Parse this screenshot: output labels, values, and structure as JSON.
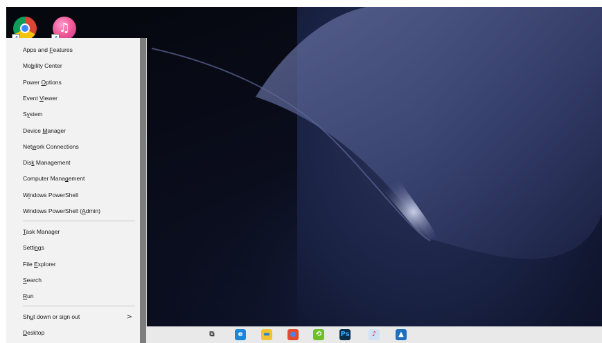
{
  "desktop": {
    "icons": [
      {
        "name": "chrome-icon"
      },
      {
        "name": "itunes-icon",
        "glyph": "♫"
      }
    ]
  },
  "menu": {
    "group1": [
      {
        "pre": "Apps and ",
        "u": "F",
        "post": "eatures"
      },
      {
        "pre": "Mo",
        "u": "b",
        "post": "ility Center"
      },
      {
        "pre": "Power ",
        "u": "O",
        "post": "ptions"
      },
      {
        "pre": "Event ",
        "u": "V",
        "post": "iewer"
      },
      {
        "pre": "S",
        "u": "y",
        "post": "stem"
      },
      {
        "pre": "Device ",
        "u": "M",
        "post": "anager"
      },
      {
        "pre": "Net",
        "u": "w",
        "post": "ork Connections"
      },
      {
        "pre": "Dis",
        "u": "k",
        "post": " Management"
      },
      {
        "pre": "Computer Mana",
        "u": "g",
        "post": "ement"
      },
      {
        "pre": "W",
        "u": "i",
        "post": "ndows PowerShell"
      },
      {
        "pre": "Windows PowerShell (",
        "u": "A",
        "post": "dmin)"
      }
    ],
    "group2": [
      {
        "pre": "",
        "u": "T",
        "post": "ask Manager"
      },
      {
        "pre": "Setti",
        "u": "n",
        "post": "gs"
      },
      {
        "pre": "File ",
        "u": "E",
        "post": "xplorer"
      },
      {
        "pre": "",
        "u": "S",
        "post": "earch"
      },
      {
        "pre": "",
        "u": "R",
        "post": "un"
      }
    ],
    "group3": [
      {
        "pre": "Sh",
        "u": "u",
        "post": "t down or sign out",
        "chevron": ">"
      },
      {
        "pre": "",
        "u": "D",
        "post": "esktop"
      }
    ]
  },
  "taskbar": {
    "icons": [
      {
        "name": "task-view-icon",
        "glyph": "⧉",
        "color": "#e9e9e9",
        "fg": "#333333"
      },
      {
        "name": "edge-icon",
        "glyph": "e",
        "color": "#1c87d6",
        "fg": "#ffffff"
      },
      {
        "name": "file-explorer-icon",
        "glyph": "▬",
        "color": "#f2c230",
        "fg": "#2d7fd3"
      },
      {
        "name": "chrome-taskbar-icon",
        "glyph": "●",
        "color": "#e64a2e",
        "fg": "#4285f4"
      },
      {
        "name": "green-app-icon",
        "glyph": "⟲",
        "color": "#6fbf2c",
        "fg": "#ffffff"
      },
      {
        "name": "photoshop-icon",
        "glyph": "Ps",
        "color": "#0b2d4a",
        "fg": "#31a8ff"
      },
      {
        "name": "itunes-taskbar-icon",
        "glyph": "♪",
        "color": "#cfe1f5",
        "fg": "#d0273c"
      },
      {
        "name": "photos-icon",
        "glyph": "▲",
        "color": "#1f6fbf",
        "fg": "#ffffff"
      }
    ]
  }
}
